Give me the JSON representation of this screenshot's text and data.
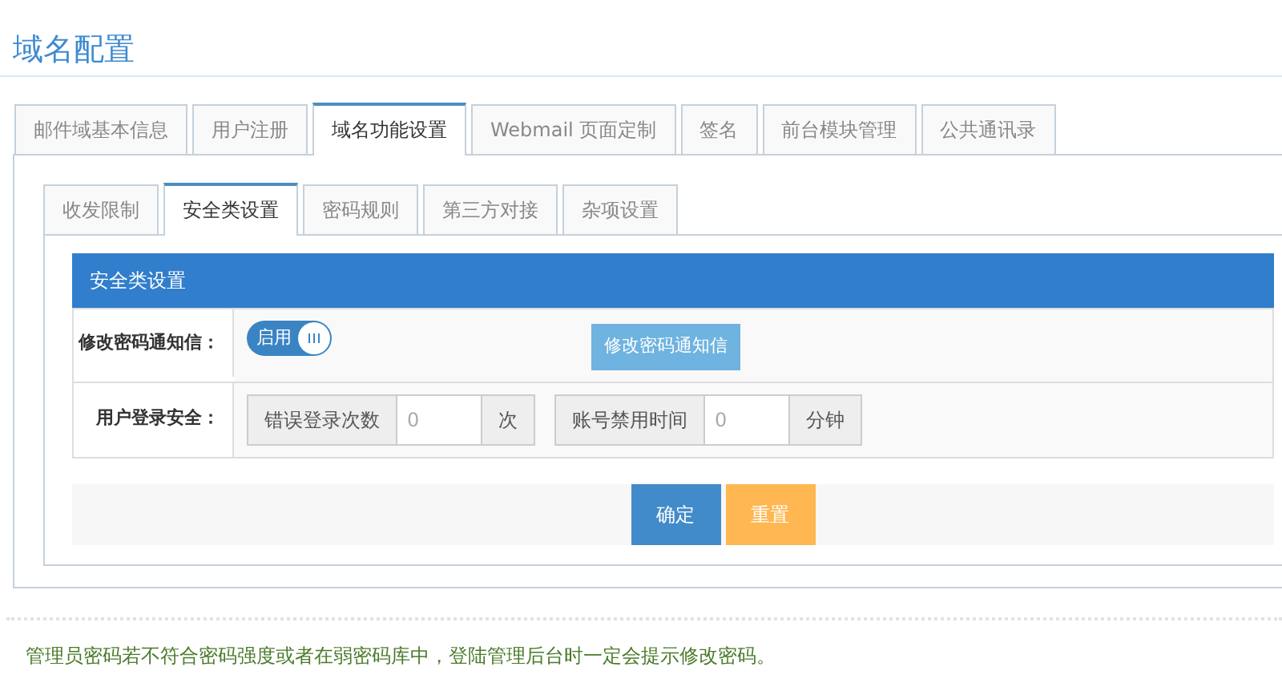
{
  "title": "域名配置",
  "outer_tabs": [
    {
      "label": "邮件域基本信息",
      "selected": false
    },
    {
      "label": "用户注册",
      "selected": false
    },
    {
      "label": "域名功能设置",
      "selected": true
    },
    {
      "label": "Webmail 页面定制",
      "selected": false
    },
    {
      "label": "签名",
      "selected": false
    },
    {
      "label": "前台模块管理",
      "selected": false
    },
    {
      "label": "公共通讯录",
      "selected": false
    }
  ],
  "inner_tabs": [
    {
      "label": "收发限制",
      "selected": false
    },
    {
      "label": "安全类设置",
      "selected": true
    },
    {
      "label": "密码规则",
      "selected": false
    },
    {
      "label": "第三方对接",
      "selected": false
    },
    {
      "label": "杂项设置",
      "selected": false
    }
  ],
  "section": {
    "header": "安全类设置",
    "rows": [
      {
        "kind": "toggle",
        "label": "修改密码通知信：",
        "toggle": {
          "text": "启用",
          "on": true
        },
        "button": "修改密码通知信"
      },
      {
        "kind": "inputs",
        "label": "用户登录安全：",
        "groups": [
          {
            "prefix": "错误登录次数",
            "placeholder": "0",
            "suffix": "次"
          },
          {
            "prefix": "账号禁用时间",
            "placeholder": "0",
            "suffix": "分钟"
          }
        ]
      }
    ]
  },
  "buttons": [
    {
      "label": "确定",
      "kind": "primary"
    },
    {
      "label": "重置",
      "kind": "warning"
    }
  ],
  "note": "管理员密码若不符合密码强度或者在弱密码库中，登陆管理后台时一定会提示修改密码。"
}
